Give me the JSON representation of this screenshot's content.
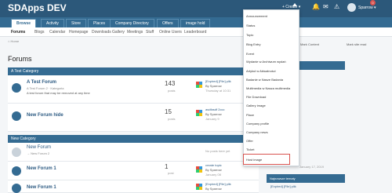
{
  "app": {
    "title": "SDApps DEV"
  },
  "topbar": {
    "create_label": "+ Create ▾",
    "user_label": "Sparrow ▾",
    "badge": "0"
  },
  "nav": {
    "tabs": [
      "Browse",
      "Activity",
      "Store",
      "Places",
      "Company Directory",
      "Offers",
      "image hold"
    ]
  },
  "subnav": {
    "items": [
      "Forums",
      "Blogs",
      "Calendar",
      "Homepage",
      "Downloads",
      "Gallery",
      "Meetings",
      "Stuff",
      "Online Users",
      "Leaderboard"
    ]
  },
  "crumb": "⌂ Home",
  "page_title": "Forums",
  "categories": [
    {
      "name": "A Test Category",
      "forums": [
        {
          "name": "A Test Forum",
          "sub": "A Test Forum 2 · Kategoria",
          "desc": "A test forum that may be removed at any time",
          "count": "143",
          "count_label": "posts",
          "lp_title": "[Expired] [File] plik",
          "lp_by": "By Sparrow",
          "lp_date": "Thursday at 10:31"
        },
        {
          "name": "New Forum hide",
          "sub": "",
          "desc": "",
          "count": "15",
          "count_label": "posts",
          "lp_title": "asdfasdf 2ccc",
          "lp_by": "By Sparrow",
          "lp_date": "January 9"
        }
      ]
    },
    {
      "name": "New Category",
      "forums": [
        {
          "name": "New Forum",
          "sub": "→ New Forum 2",
          "desc": "",
          "count": "",
          "count_label": "",
          "lp_title": "No posts here yet",
          "lp_by": "",
          "lp_date": ""
        },
        {
          "name": "New Forum 1",
          "sub": "",
          "desc": "",
          "count": "1",
          "count_label": "post",
          "lp_title": "create topic",
          "lp_by": "By Sparrow",
          "lp_date": "January 08"
        },
        {
          "name": "New Forum 1",
          "sub": "",
          "desc": "",
          "count": "",
          "count_label": "",
          "lp_title": "[Expired] [File] plik",
          "lp_by": "By Sparrow",
          "lp_date": ""
        }
      ]
    }
  ],
  "right": {
    "mark_label": "Mark Content",
    "read_label": "Mark site read",
    "updates": "Updates",
    "recent": "Recent",
    "latest_badge": "Najnowsze tematy",
    "latest_item": "[Expired] [File] plik",
    "date_item": "January 17, 2019"
  },
  "menu": {
    "items": [
      "Announcement",
      "Status",
      "Topic",
      "Blog Entry",
      "Event",
      "Wydanie w Archiwum wydań",
      "Artykuł w Aktualności",
      "Badanie w Nasze Badania",
      "Multimedia w Nasza multimedia",
      "File Download",
      "Gallery image",
      "Place",
      "Company profile",
      "Company news",
      "Offer",
      "Ticket",
      "Host image"
    ],
    "highlighted": "Host image"
  }
}
